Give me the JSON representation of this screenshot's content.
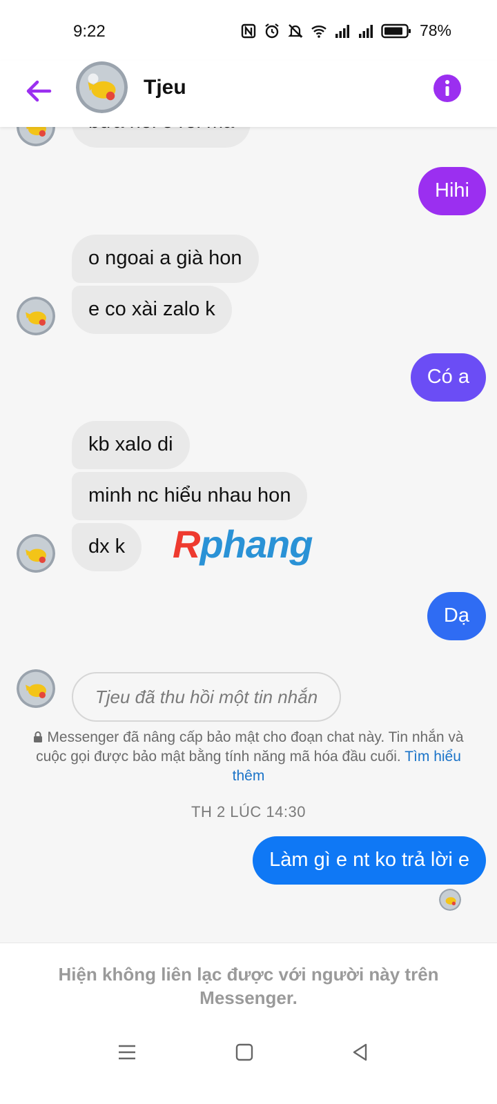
{
  "status": {
    "time": "9:22",
    "battery": "78%"
  },
  "header": {
    "name": "Tjeu"
  },
  "messages": {
    "top_partial": "bửa hỏi e rồi mà",
    "hihi": "Hihi",
    "m1": "o ngoai a già hon",
    "m2": "e co xài zalo k",
    "co_a": "Có a",
    "m3": "kb xalo di",
    "m4": "minh nc hiểu nhau hon",
    "m5": "dx k",
    "da": "Dạ",
    "recalled": "Tjeu đã thu hồi một tin nhắn",
    "last": "Làm gì e nt ko trả lời e"
  },
  "security": {
    "text": "Messenger đã nâng cấp bảo mật cho đoạn chat này. Tin nhắn và cuộc gọi được bảo mật bằng tính năng mã hóa đầu cuối.",
    "link": "Tìm hiểu thêm"
  },
  "timestamp": "TH 2 LÚC 14:30",
  "watermark": {
    "first": "R",
    "rest": "phang"
  },
  "footer": {
    "text": "Hiện không liên lạc được với người này trên Messenger."
  },
  "colors": {
    "accent": "#9b2ff0",
    "bubble_mid": "#6b4df5",
    "bubble_blue": "#2f6cf3",
    "bubble_last": "#0f78f5",
    "incoming": "#e9e9e9"
  },
  "icons": [
    "nfc-icon",
    "alarm-icon",
    "mute-icon",
    "wifi-icon",
    "signal-icon",
    "battery-icon",
    "back-arrow-icon",
    "info-icon",
    "lock-icon",
    "menu-icon",
    "home-icon",
    "back-triangle-icon"
  ]
}
